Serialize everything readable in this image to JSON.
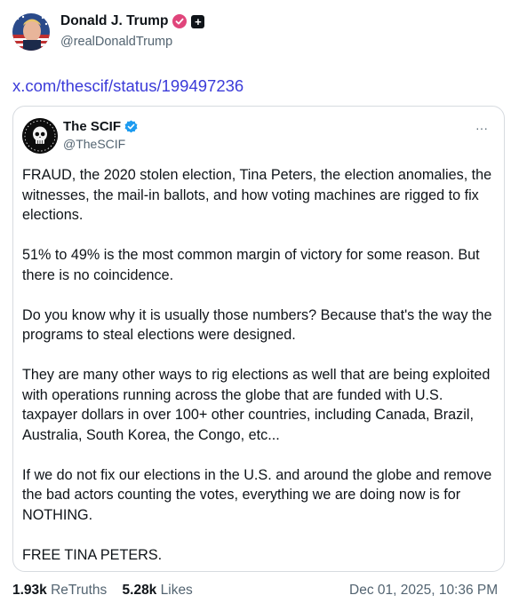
{
  "post": {
    "author_name": "Donald J. Trump",
    "author_handle": "@realDonaldTrump",
    "link_text": "x.com/thescif/status/199497236",
    "badge_icon": "verified-pink-icon",
    "plus_icon": "plus-badge-icon"
  },
  "quoted": {
    "author_name": "The SCIF",
    "author_handle": "@TheSCIF",
    "more_label": "···",
    "paragraphs": [
      "FRAUD, the 2020 stolen election, Tina Peters, the election anomalies, the witnesses, the mail-in ballots, and how voting machines are rigged to fix elections.",
      "51% to 49% is the most common margin of victory for some reason. But there is no coincidence.",
      "Do you know why it is usually those numbers? Because that's the way the programs to steal elections were designed.",
      "They are many other ways to rig elections as well that are being exploited with operations running across the globe that are funded with U.S. taxpayer dollars in over 100+ other countries, including Canada, Brazil, Australia, South Korea, the Congo, etc...",
      "If we do not fix our elections in the U.S. and around the globe and remove the bad actors counting the votes, everything we are doing now is for NOTHING.",
      "FREE TINA PETERS."
    ]
  },
  "stats": {
    "retruths_count": "1.93k",
    "retruths_label": "ReTruths",
    "likes_count": "5.28k",
    "likes_label": "Likes",
    "timestamp": "Dec 01, 2025, 10:36 PM"
  },
  "colors": {
    "link": "#3b3bd9",
    "verified_pink": "#e0457b",
    "verified_blue": "#1d9bf0",
    "muted": "#536471"
  }
}
